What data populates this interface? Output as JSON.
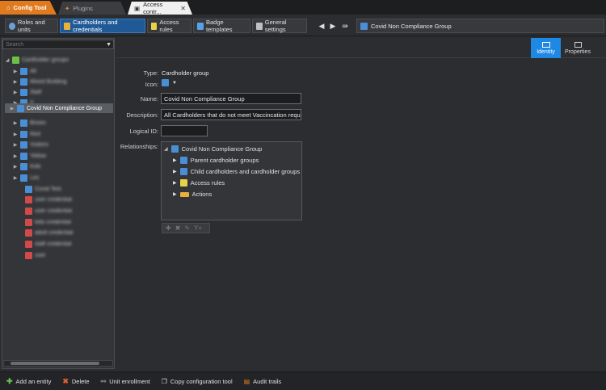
{
  "tabs": {
    "app": "Config Tool",
    "plugins": "Plugins",
    "access": "Access contr..."
  },
  "toolbar": {
    "roles": "Roles and units",
    "cardholders": "Cardholders and credentials",
    "access_rules": "Access rules",
    "badge_templates": "Badge templates",
    "general_settings": "General settings"
  },
  "breadcrumb": "Covid Non Compliance Group",
  "search": {
    "placeholder": "Search"
  },
  "tree": {
    "items": [
      {
        "label": "Cardholder groups"
      },
      {
        "label": "All"
      },
      {
        "label": "Mixed Building"
      },
      {
        "label": "Staff"
      },
      {
        "label": "X"
      },
      {
        "label": "Covid Non Compliance Group"
      },
      {
        "label": "Brown"
      },
      {
        "label": "Red"
      },
      {
        "label": "Visitors"
      },
      {
        "label": "Yellow"
      },
      {
        "label": "Kids"
      },
      {
        "label": "Les"
      },
      {
        "label": "Covid Test"
      },
      {
        "label": "user credential"
      },
      {
        "label": "user credential"
      },
      {
        "label": "kids credential"
      },
      {
        "label": "adult credential"
      },
      {
        "label": "staff credential"
      },
      {
        "label": "user"
      }
    ]
  },
  "right_tabs": {
    "identity": "Identity",
    "properties": "Properties"
  },
  "form": {
    "type_label": "Type:",
    "type_value": "Cardholder group",
    "icon_label": "Icon:",
    "name_label": "Name:",
    "name_value": "Covid Non Compliance Group",
    "desc_label": "Description:",
    "desc_value": "All Cardholders that do not meet Vaccincation requirem",
    "logical_label": "Logical ID:",
    "logical_value": "",
    "rel_label": "Relationships:"
  },
  "relationships": {
    "root": "Covid Non Compliance Group",
    "children": [
      "Parent cardholder groups",
      "Child cardholders and cardholder groups",
      "Access rules",
      "Actions"
    ]
  },
  "bottom": {
    "add": "Add an entity",
    "delete": "Delete",
    "unit_enrollment": "Unit enrollment",
    "copy_config": "Copy configuration tool",
    "audit": "Audit trails"
  },
  "colors": {
    "accent": "#1e88e5",
    "app_tab": "#e07a1e",
    "active_toolbar": "#1f5a96"
  }
}
